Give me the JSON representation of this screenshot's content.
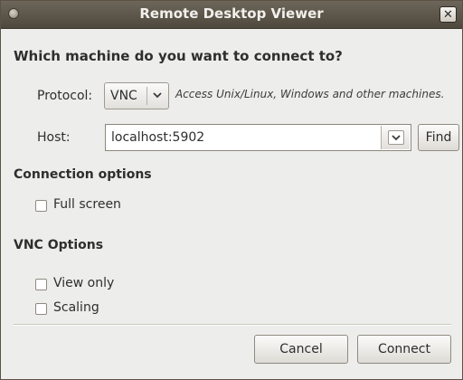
{
  "window": {
    "title": "Remote Desktop Viewer"
  },
  "heading": "Which machine do you want to connect to?",
  "protocol": {
    "label": "Protocol:",
    "value": "VNC",
    "hint": "Access Unix/Linux, Windows and other machines."
  },
  "host": {
    "label": "Host:",
    "value": "localhost:5902",
    "find_label": "Find"
  },
  "connection_options": {
    "title": "Connection options",
    "full_screen_label": "Full screen",
    "full_screen_checked": false
  },
  "vnc_options": {
    "title": "VNC Options",
    "view_only_label": "View only",
    "view_only_checked": false,
    "scaling_label": "Scaling",
    "scaling_checked": false
  },
  "buttons": {
    "cancel": "Cancel",
    "connect": "Connect"
  },
  "icons": {
    "window_menu": "window-menu-icon",
    "close": "close-icon",
    "dropdown": "chevron-down-icon"
  }
}
